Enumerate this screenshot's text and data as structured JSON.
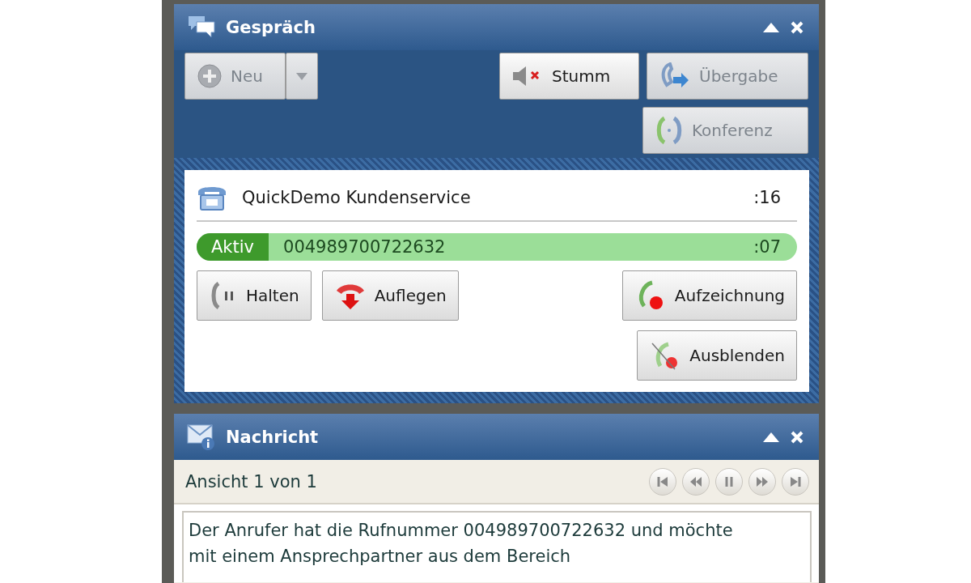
{
  "call_panel": {
    "title": "Gespräch",
    "new_button": {
      "label": "Neu",
      "disabled": true
    },
    "actions": [
      {
        "label": "Stumm",
        "disabled": false
      },
      {
        "label": "Übergabe",
        "disabled": true
      },
      {
        "label": "Konferenz",
        "disabled": true
      }
    ],
    "call": {
      "name": "QuickDemo Kundenservice",
      "duration": ":16",
      "status": "Aktiv",
      "number": "004989700722632",
      "line_duration": ":07",
      "buttons": [
        {
          "label": "Halten"
        },
        {
          "label": "Auflegen"
        },
        {
          "label": "Aufzeichnung"
        },
        {
          "label": "Ausblenden"
        }
      ]
    }
  },
  "message_panel": {
    "title": "Nachricht",
    "view": "Ansicht 1 von 1",
    "text": "Der Anrufer hat die Rufnummer 004989700722632 und möchte mit einem Ansprechpartner aus dem Bereich"
  }
}
